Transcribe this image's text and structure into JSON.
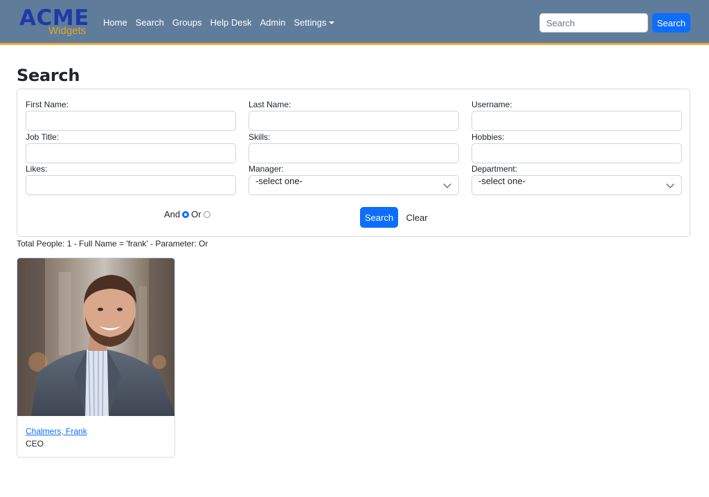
{
  "brand": {
    "name": "ACME",
    "sub": "Widgets"
  },
  "nav": {
    "links": [
      "Home",
      "Search",
      "Groups",
      "Help Desk",
      "Admin",
      "Settings"
    ],
    "search_placeholder": "Search",
    "search_button": "Search"
  },
  "page": {
    "title": "Search"
  },
  "form": {
    "first_name": {
      "label": "First Name:",
      "value": ""
    },
    "last_name": {
      "label": "Last Name:",
      "value": ""
    },
    "username": {
      "label": "Username:",
      "value": ""
    },
    "job_title": {
      "label": "Job Title:",
      "value": ""
    },
    "skills": {
      "label": "Skills:",
      "value": ""
    },
    "hobbies": {
      "label": "Hobbies:",
      "value": ""
    },
    "likes": {
      "label": "Likes:",
      "value": ""
    },
    "manager": {
      "label": "Manager:",
      "selected": "-select one-"
    },
    "department": {
      "label": "Department:",
      "selected": "-select one-"
    },
    "logic": {
      "and_label": "And",
      "or_label": "Or",
      "selected": "And"
    },
    "search_button": "Search",
    "clear_button": "Clear"
  },
  "results": {
    "summary": "Total People: 1 - Full Name = 'frank' - Parameter: Or",
    "people": [
      {
        "name": "Chalmers, Frank",
        "title": "CEO"
      }
    ]
  },
  "colors": {
    "navbar": "#5f7d9b",
    "accent_border": "#f4a52e",
    "primary": "#0d6efd",
    "logo_blue": "#1f3aa8",
    "logo_gold": "#e2a623"
  },
  "icons": {
    "select_arrow": "chevron-down-icon"
  }
}
